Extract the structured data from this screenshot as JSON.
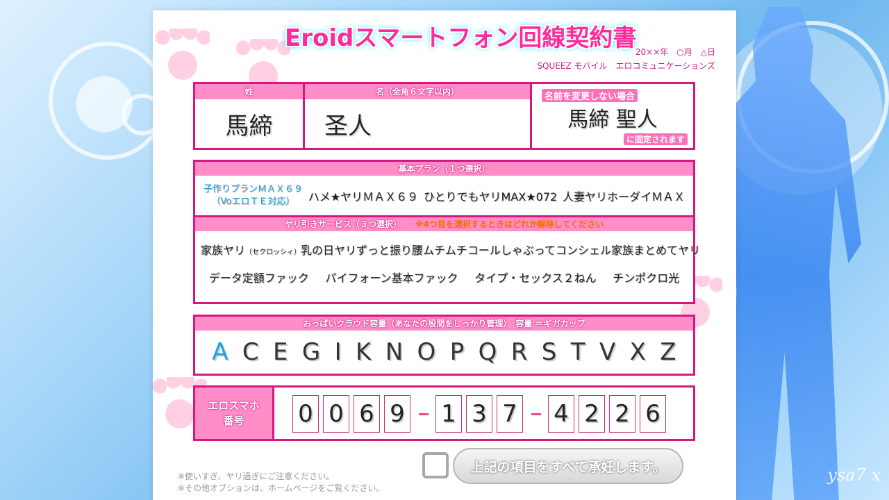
{
  "document": {
    "title": "Eroidスマートフォン回線契約書",
    "date": "20××年　○月　△日",
    "company": "SQUEEZ モバイル　エロコミュニケーションズ"
  },
  "name_section": {
    "surname_header": "姓",
    "surname_value": "馬締",
    "given_header": "名（全角６文字以内）",
    "given_value": "圣人",
    "note_label": "名前を変更しない場合",
    "note_value": "馬締 聖人",
    "note_suffix": "に固定されます"
  },
  "plan_section": {
    "header": "基本プラン（１つ選択）",
    "options": [
      {
        "line1": "子作りプランＭＡＸ６９",
        "line2": "（VoエロＴＥ対応）",
        "selected": true
      },
      {
        "line1": "ハメ★ヤリＭＡＸ６９",
        "selected": false
      },
      {
        "line1": "ひとりでもヤリMAX★072",
        "selected": false
      },
      {
        "line1": "人妻ヤリホーダイＭＡＸ",
        "selected": false
      }
    ]
  },
  "service_section": {
    "header": "ヤリ引きサービス（３つ選択）",
    "warning": "※4つ目を選択するときはどれか解除してください",
    "row1": [
      {
        "label": "家族ヤリ",
        "sub": "（セクロッシィ）"
      },
      {
        "label": "乳の日ヤリ"
      },
      {
        "label": "ずっと振り腰"
      },
      {
        "label": "ムチムチコール"
      },
      {
        "label": "しゃぶってコンシェル"
      },
      {
        "label": "家族まとめてヤリ"
      }
    ],
    "row2": [
      {
        "label": "データ定額ファック"
      },
      {
        "label": "パイフォーン基本ファック"
      },
      {
        "label": "タイプ・セックス２ねん"
      },
      {
        "label": "チンポクロ光"
      }
    ]
  },
  "cloud_section": {
    "header": "おっぱいクラウド容量（あなたの股間をしっかり管理）　容量 ＝ギガカップ",
    "letters": [
      "A",
      "C",
      "E",
      "G",
      "I",
      "K",
      "N",
      "O",
      "P",
      "Q",
      "R",
      "S",
      "T",
      "V",
      "X",
      "Z"
    ],
    "selected": "A"
  },
  "phone_section": {
    "label_line1": "エロスマホ",
    "label_line2": "番号",
    "group1": [
      "0",
      "0",
      "6",
      "9"
    ],
    "group2": [
      "1",
      "3",
      "7"
    ],
    "group3": [
      "4",
      "2",
      "2",
      "6"
    ]
  },
  "footer": {
    "note1": "※使いすぎ、ヤリ過ぎにご注意ください。",
    "note2": "※その他オプションは、ホームページをご覧ください。",
    "accept_label": "上記の項目をすべて承妊します。"
  },
  "watermark": "ysa7 x",
  "colors": {
    "accent": "#d9157f",
    "header_pink": "#ff8dc8",
    "selected_blue": "#1aa0e6"
  }
}
